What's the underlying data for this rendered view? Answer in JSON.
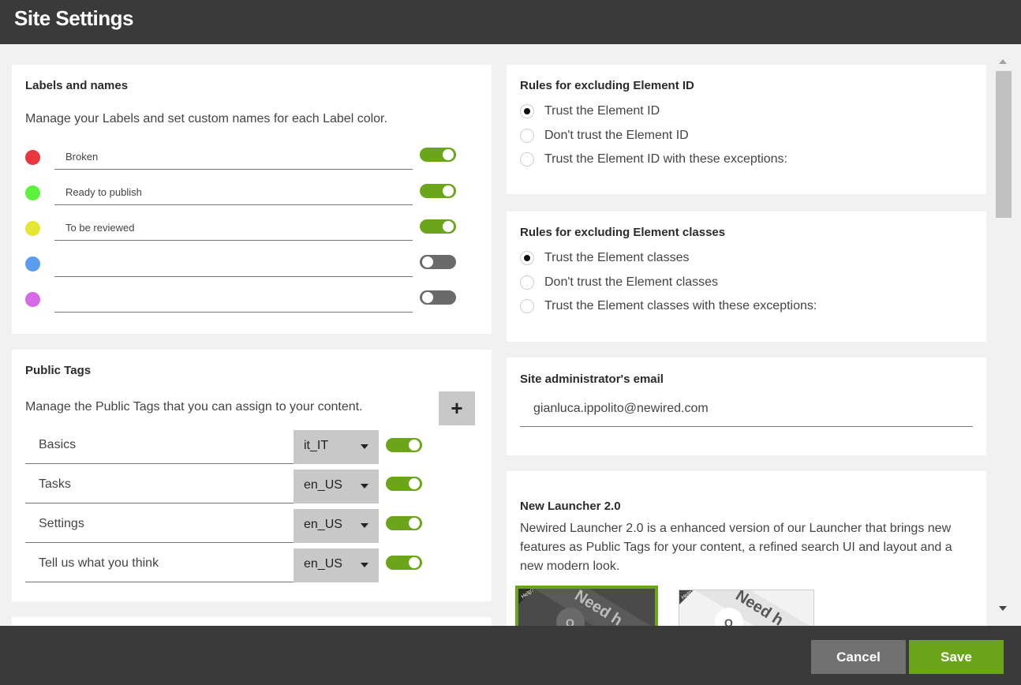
{
  "header": {
    "title": "Site Settings"
  },
  "labels": {
    "title": "Labels and names",
    "description": "Manage your Labels and set custom names for each Label color.",
    "items": [
      {
        "color": "#e8373e",
        "name": "Broken",
        "enabled": true
      },
      {
        "color": "#5cf23c",
        "name": "Ready to publish",
        "enabled": true
      },
      {
        "color": "#e6e634",
        "name": "To be reviewed",
        "enabled": true
      },
      {
        "color": "#5a9cf0",
        "name": "",
        "enabled": false
      },
      {
        "color": "#d76ae8",
        "name": "",
        "enabled": false
      }
    ]
  },
  "public_tags": {
    "title": "Public Tags",
    "description": "Manage the Public Tags that you can assign to your content.",
    "add_label": "+",
    "items": [
      {
        "name": "Basics",
        "locale": "it_IT",
        "enabled": true
      },
      {
        "name": "Tasks",
        "locale": "en_US",
        "enabled": true
      },
      {
        "name": "Settings",
        "locale": "en_US",
        "enabled": true
      },
      {
        "name": "Tell us what you think",
        "locale": "en_US",
        "enabled": true
      }
    ]
  },
  "element_id": {
    "title": "Rules for excluding Element ID",
    "options": [
      {
        "label": "Trust the Element ID",
        "checked": true
      },
      {
        "label": "Don't trust the Element ID",
        "checked": false
      },
      {
        "label": "Trust the Element ID with these exceptions:",
        "checked": false
      }
    ]
  },
  "element_classes": {
    "title": "Rules for excluding Element classes",
    "options": [
      {
        "label": "Trust the Element classes",
        "checked": true
      },
      {
        "label": "Don't trust the Element classes",
        "checked": false
      },
      {
        "label": "Trust the Element classes with these exceptions:",
        "checked": false
      }
    ]
  },
  "admin_email": {
    "title": "Site administrator's email",
    "value": "gianluca.ippolito@newired.com"
  },
  "launcher": {
    "title": "New Launcher 2.0",
    "description": "Newired Launcher 2.0 is a enhanced version of our Launcher that brings new features as Public Tags for your content, a refined search UI and layout and a new modern look.",
    "thumb_badge": "Help?",
    "thumb_text": "Need h",
    "thumb_letter": "Q",
    "themes": [
      {
        "theme": "dark",
        "selected": true
      },
      {
        "theme": "light",
        "selected": false
      }
    ]
  },
  "footer": {
    "cancel_label": "Cancel",
    "save_label": "Save"
  },
  "colors": {
    "accent": "#6aa51a",
    "header": "#3a3a3a"
  }
}
